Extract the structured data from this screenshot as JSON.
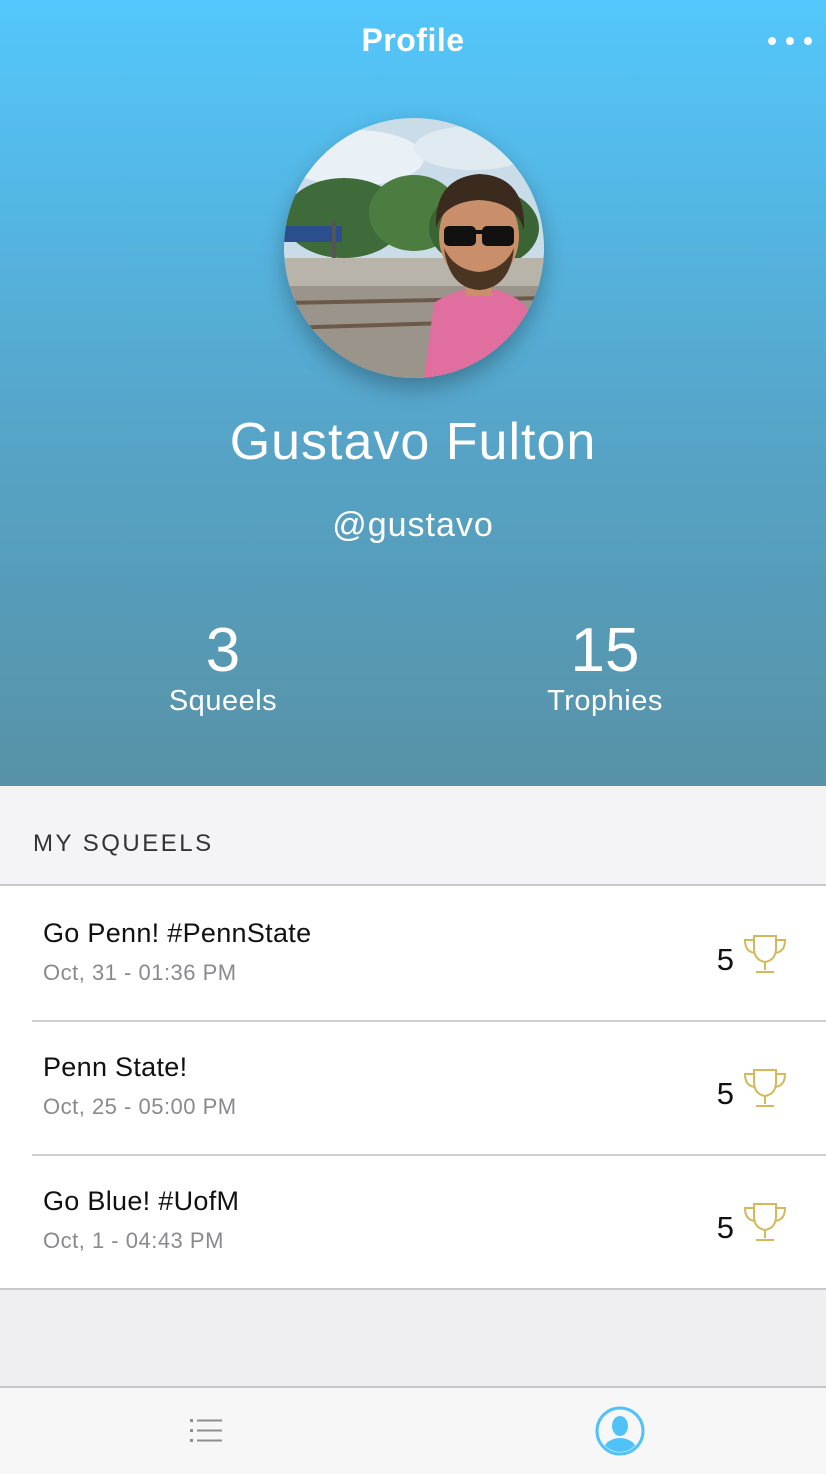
{
  "nav": {
    "title": "Profile",
    "more_icon": "more-horizontal-icon"
  },
  "profile": {
    "name": "Gustavo Fulton",
    "handle": "@gustavo",
    "stats": [
      {
        "value": "3",
        "label": "Squeels"
      },
      {
        "value": "15",
        "label": "Trophies"
      }
    ]
  },
  "section": {
    "title": "MY SQUEELS"
  },
  "squeels": [
    {
      "text": "Go Penn! #PennState",
      "time": "Oct, 31 - 01:36 PM",
      "trophies": "5"
    },
    {
      "text": "Penn State!",
      "time": "Oct, 25 - 05:00 PM",
      "trophies": "5"
    },
    {
      "text": "Go Blue! #UofM",
      "time": "Oct, 1 - 04:43 PM",
      "trophies": "5"
    }
  ],
  "tabs": [
    {
      "icon": "list-icon",
      "active": false
    },
    {
      "icon": "profile-icon",
      "active": true
    }
  ],
  "colors": {
    "accent": "#4fc3f7",
    "trophy": "#d4b85a",
    "hero_top": "#53c7fc",
    "hero_bottom": "#5792a7"
  }
}
